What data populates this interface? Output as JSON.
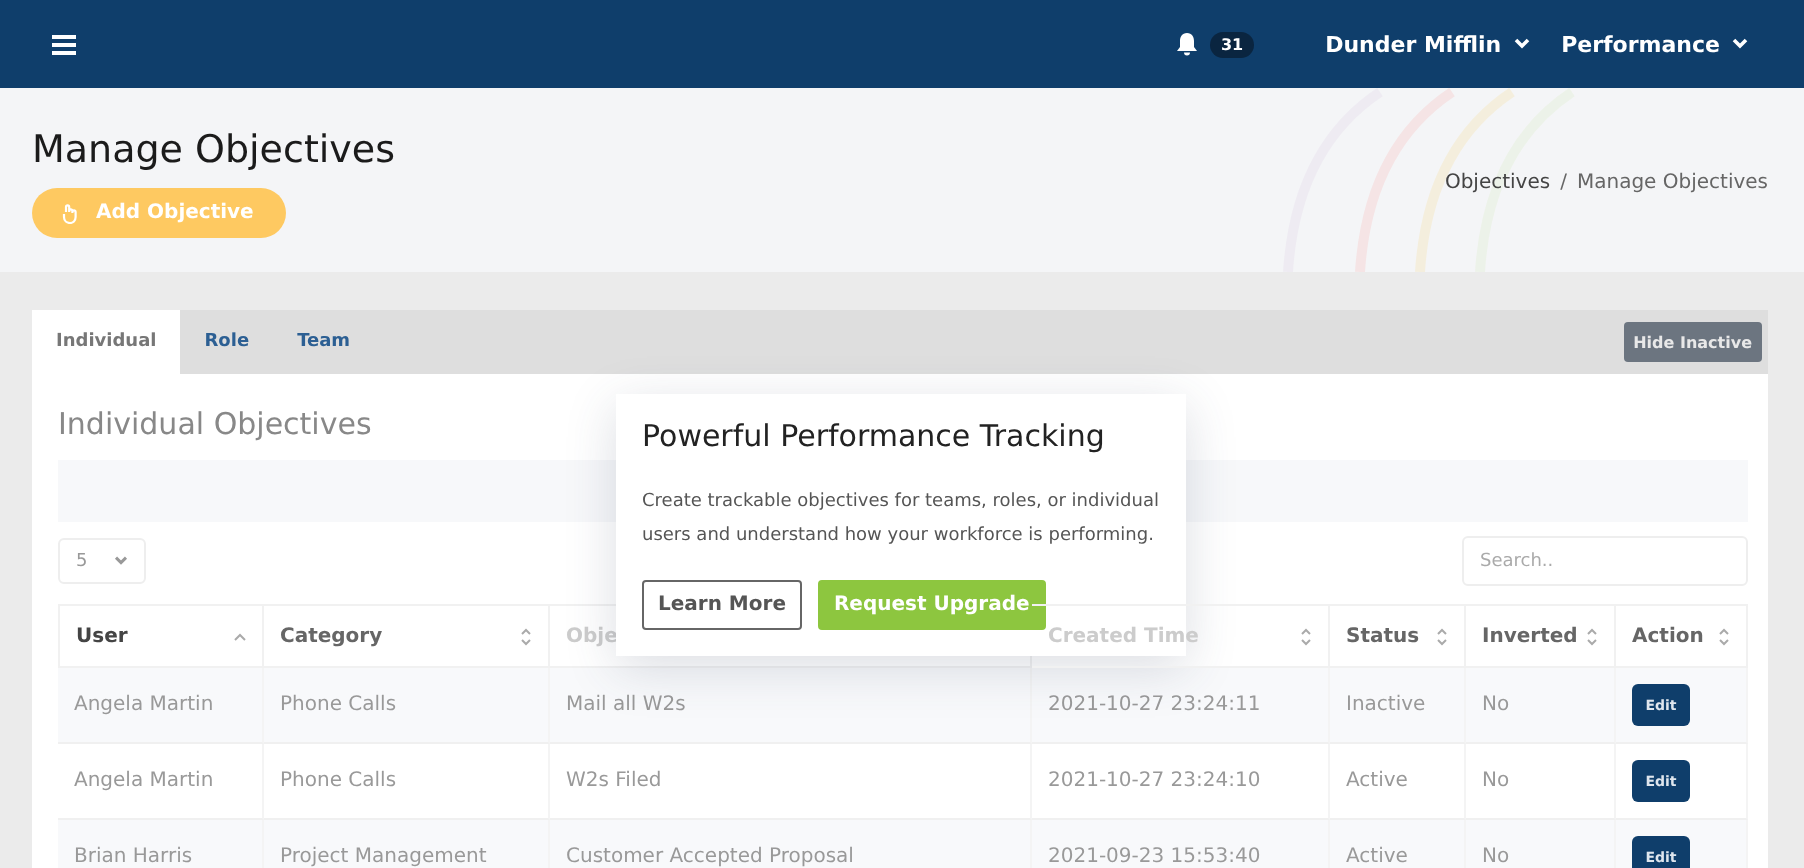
{
  "navbar": {
    "notification_count": "31",
    "menus": [
      "Dunder Mifflin",
      "Performance"
    ]
  },
  "header": {
    "title": "Manage Objectives",
    "add_button": "Add Objective",
    "breadcrumb": [
      "Objectives",
      "/",
      "Manage Objectives"
    ]
  },
  "tabs": [
    {
      "label": "Individual",
      "selected": true
    },
    {
      "label": "Role",
      "selected": false
    },
    {
      "label": "Team",
      "selected": false
    }
  ],
  "hide_button": "Hide Inactive",
  "section_title": "Individual Objectives",
  "page_size": "5",
  "search": {
    "placeholder": "Search.."
  },
  "table": {
    "columns": [
      {
        "label": "User",
        "sorted": true
      },
      {
        "label": "Category",
        "sorted": false
      },
      {
        "label": "Obje"
      },
      {
        "label": "Created Time",
        "sorted": false
      },
      {
        "label": "Status",
        "sorted": false
      },
      {
        "label": "Inverted",
        "sorted": false
      },
      {
        "label": "Action",
        "sorted": false
      }
    ],
    "rows": [
      {
        "cells": [
          "Angela Martin",
          "Phone Calls",
          "Mail all W2s",
          "2021-10-27 23:24:11",
          "Inactive",
          "No"
        ],
        "action": "Edit"
      },
      {
        "cells": [
          "Angela Martin",
          "Phone Calls",
          "W2s Filed",
          "2021-10-27 23:24:10",
          "Active",
          "No"
        ],
        "action": "Edit"
      },
      {
        "cells": [
          "Brian Harris",
          "Project Management",
          "Customer Accepted Proposal",
          "2021-09-23 15:53:40",
          "Active",
          "No"
        ],
        "action": "Edit"
      }
    ]
  },
  "popup": {
    "title": "Powerful Performance Tracking",
    "text": "Create trackable objectives for teams, roles, or individual users and understand how your workforce is performing.",
    "buttons": [
      {
        "label": "Learn More",
        "kind": "outline"
      },
      {
        "label": "Request Upgrade",
        "kind": "primary"
      }
    ]
  }
}
